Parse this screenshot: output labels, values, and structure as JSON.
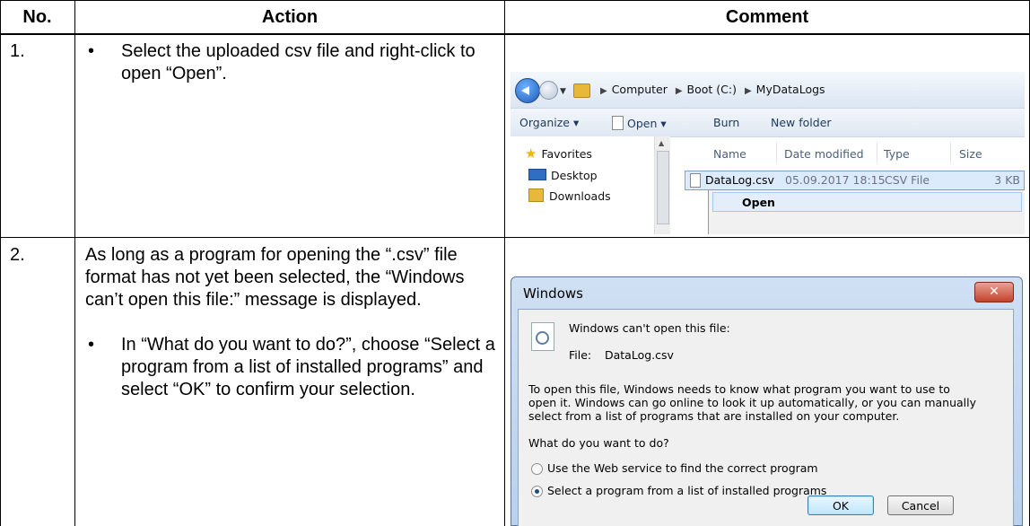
{
  "table": {
    "headers": {
      "no": "No.",
      "action": "Action",
      "comment": "Comment"
    },
    "rows": [
      {
        "no": "1.",
        "bullet": "Select the uploaded csv file and right-click to open “Open”."
      },
      {
        "no": "2.",
        "intro": "As long as a program for opening the “.csv” file format has not yet been selected, the “Windows can’t open this file:” message is displayed.",
        "bullet": "In “What do you want to do?”, choose “Select a program from a list of installed programs” and select “OK” to confirm your selection."
      }
    ]
  },
  "explorer": {
    "breadcrumb": [
      "Computer",
      "Boot (C:)",
      "MyDataLogs"
    ],
    "toolbar": {
      "organize": "Organize ▾",
      "open": "Open ▾",
      "burn": "Burn",
      "new_folder": "New folder"
    },
    "nav": {
      "favorites": "Favorites",
      "desktop": "Desktop",
      "downloads": "Downloads"
    },
    "columns": {
      "name": "Name",
      "date": "Date modified",
      "type": "Type",
      "size": "Size"
    },
    "file": {
      "name": "DataLog.csv",
      "date": "05.09.2017 18:15",
      "type": "CSV File",
      "size": "3 KB"
    },
    "context_menu": {
      "open": "Open"
    }
  },
  "dialog": {
    "title": "Windows",
    "close": "✕",
    "heading": "Windows can't open this file:",
    "file_label": "File:",
    "file_name": "DataLog.csv",
    "desc_lines": [
      "To open this file, Windows needs to know what program you want to use to",
      "open it. Windows can go online to look it up automatically, or you can manually",
      "select from a list of programs that are installed on your computer."
    ],
    "question": "What do you want to do?",
    "options": [
      "Use the Web service to find the correct program",
      "Select a program from a list of installed programs"
    ],
    "ok": "OK",
    "cancel": "Cancel"
  }
}
